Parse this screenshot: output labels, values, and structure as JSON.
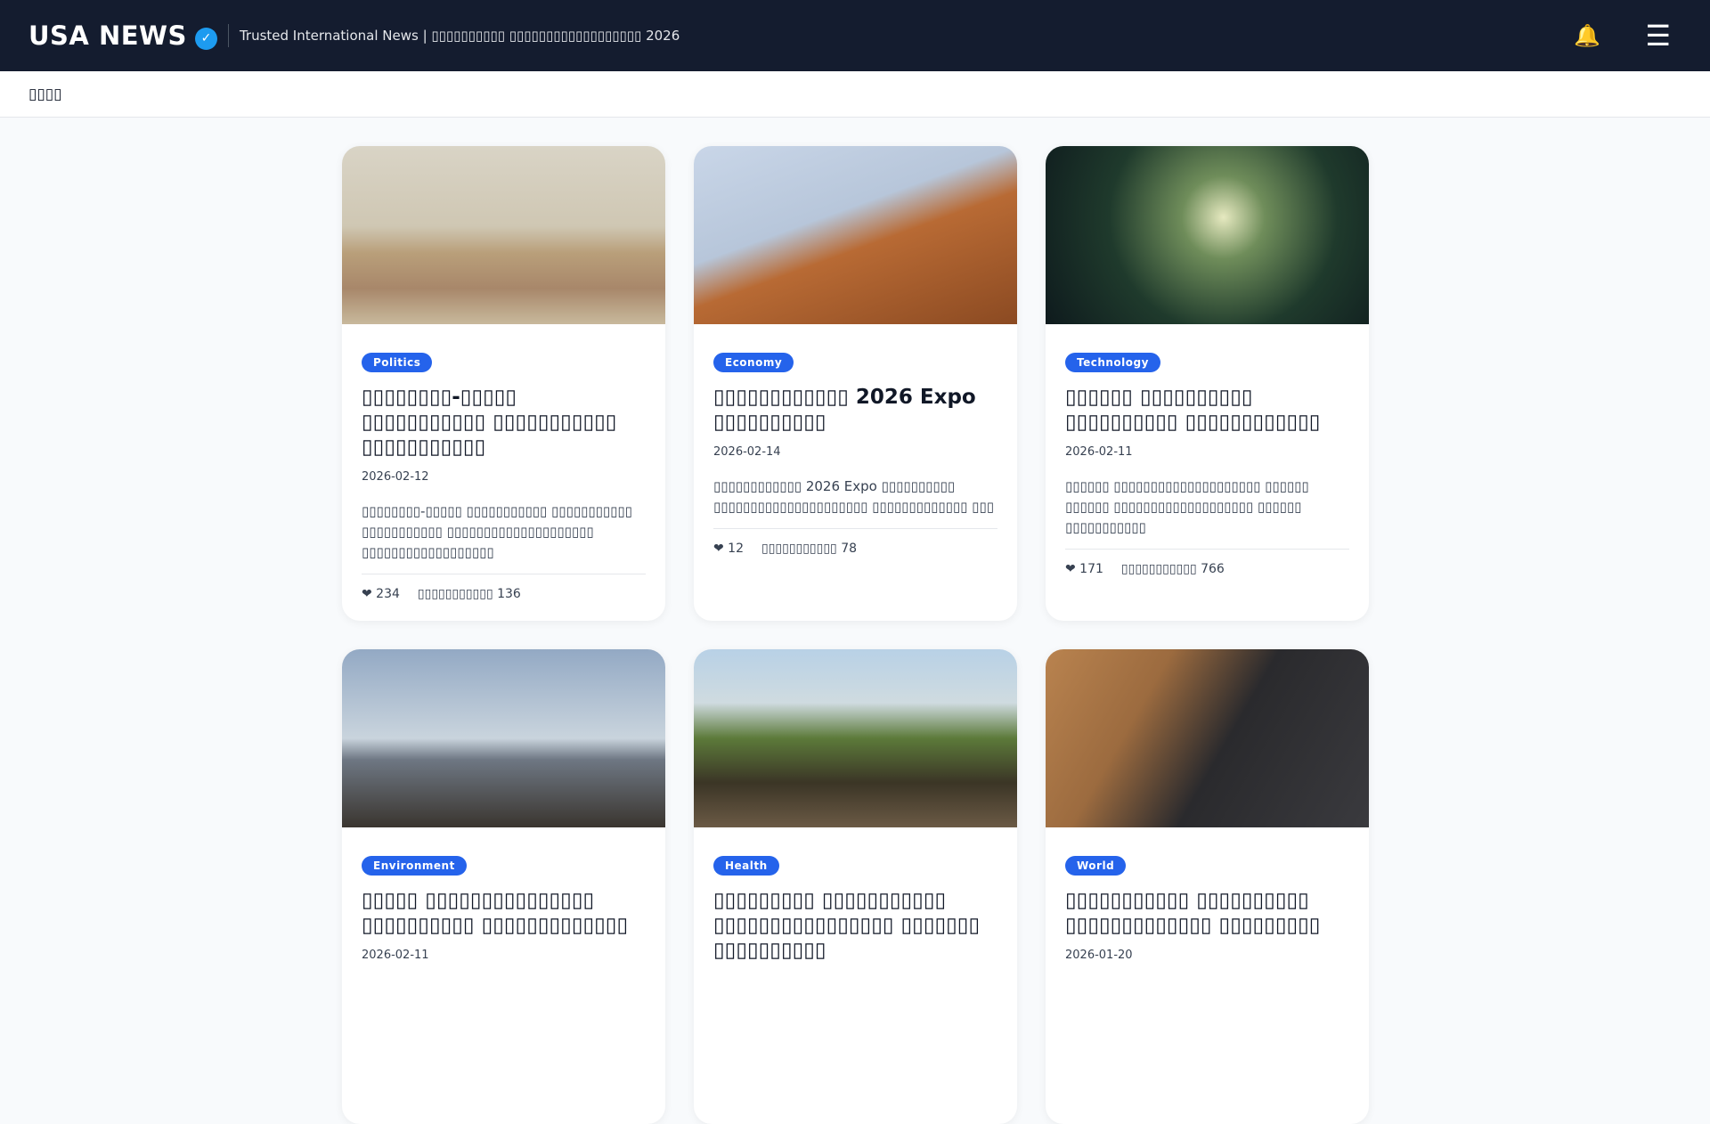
{
  "header": {
    "logo": "USA NEWS",
    "verified": "✓",
    "tagline": "Trusted International News | ▯▯▯▯▯▯▯▯▯▯ ▯▯▯▯▯▯▯▯▯▯▯▯▯▯▯▯▯▯ 2026",
    "bell_icon": "🔔",
    "menu_icon": "☰"
  },
  "subbar": {
    "label": "▯▯▯▯"
  },
  "cards": [
    {
      "category": "Politics",
      "title": "▯▯▯▯▯▯▯▯-▯▯▯▯▯ ▯▯▯▯▯▯▯▯▯▯▯ ▯▯▯▯▯▯▯▯▯▯▯ ▯▯▯▯▯▯▯▯▯▯▯",
      "date": "2026-02-12",
      "desc": "▯▯▯▯▯▯▯▯-▯▯▯▯▯ ▯▯▯▯▯▯▯▯▯▯▯ ▯▯▯▯▯▯▯▯▯▯▯ ▯▯▯▯▯▯▯▯▯▯▯ ▯▯▯▯▯▯▯▯▯▯▯▯▯▯▯▯▯▯▯▯ ▯▯▯▯▯▯▯▯▯▯▯▯▯▯▯▯▯▯",
      "likes": "❤ 234",
      "views": "▯▯▯▯▯▯▯▯▯▯▯ 136"
    },
    {
      "category": "Economy",
      "title": "▯▯▯▯▯▯▯▯▯▯▯▯ 2026 Expo ▯▯▯▯▯▯▯▯▯▯",
      "date": "2026-02-14",
      "desc": "▯▯▯▯▯▯▯▯▯▯▯▯ 2026 Expo ▯▯▯▯▯▯▯▯▯▯ ▯▯▯▯▯▯▯▯▯▯▯▯▯▯▯▯▯▯▯▯▯ ▯▯▯▯▯▯▯▯▯▯▯▯▯ ▯▯▯",
      "likes": "❤ 12",
      "views": "▯▯▯▯▯▯▯▯▯▯▯ 78"
    },
    {
      "category": "Technology",
      "title": "▯▯▯▯▯▯ ▯▯▯▯▯▯▯▯▯▯ ▯▯▯▯▯▯▯▯▯▯ ▯▯▯▯▯▯▯▯▯▯▯▯",
      "date": "2026-02-11",
      "desc": "▯▯▯▯▯▯ ▯▯▯▯▯▯▯▯▯▯▯▯▯▯▯▯▯▯▯▯ ▯▯▯▯▯▯ ▯▯▯▯▯▯ ▯▯▯▯▯▯▯▯▯▯▯▯▯▯▯▯▯▯▯ ▯▯▯▯▯▯ ▯▯▯▯▯▯▯▯▯▯▯",
      "likes": "❤ 171",
      "views": "▯▯▯▯▯▯▯▯▯▯▯ 766"
    },
    {
      "category": "Environment",
      "title": "▯▯▯▯▯ ▯▯▯▯▯▯▯▯▯▯▯▯▯▯▯ ▯▯▯▯▯▯▯▯▯▯ ▯▯▯▯▯▯▯▯▯▯▯▯▯",
      "date": "2026-02-11",
      "desc": "",
      "likes": "",
      "views": ""
    },
    {
      "category": "Health",
      "title": "▯▯▯▯▯▯▯▯▯ ▯▯▯▯▯▯▯▯▯▯▯ ▯▯▯▯▯▯▯▯▯▯▯▯▯▯▯▯ ▯▯▯▯▯▯▯ ▯▯▯▯▯▯▯▯▯▯",
      "date": "",
      "desc": "",
      "likes": "",
      "views": ""
    },
    {
      "category": "World",
      "title": "▯▯▯▯▯▯▯▯▯▯▯ ▯▯▯▯▯▯▯▯▯▯ ▯▯▯▯▯▯▯▯▯▯▯▯▯ ▯▯▯▯▯▯▯▯▯",
      "date": "2026-01-20",
      "desc": "",
      "likes": "",
      "views": ""
    }
  ]
}
